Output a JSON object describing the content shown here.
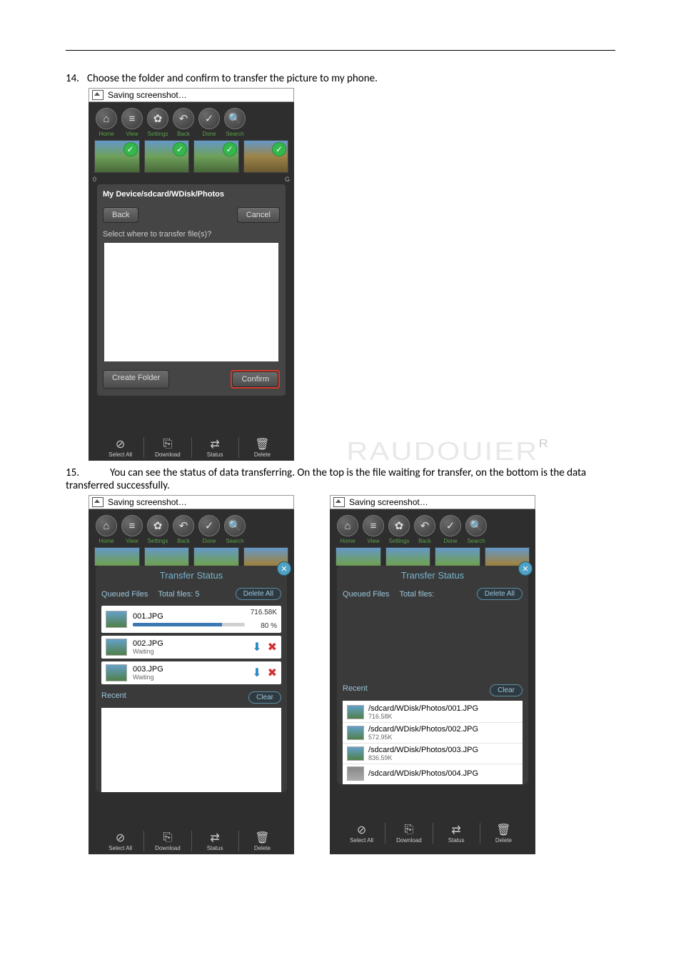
{
  "step14": {
    "num": "14.",
    "text": "Choose the folder and confirm to transfer the picture to my phone."
  },
  "step15": {
    "num": "15.",
    "text": "You can see the status of data transferring. On the top is the file waiting for transfer, on the bottom is the data transferred successfully."
  },
  "window_title": "Saving screenshot…",
  "toolbar": {
    "home": "Home",
    "view": "View",
    "settings": "Settings",
    "back": "Back",
    "done": "Done",
    "search": "Search"
  },
  "modal": {
    "path": "My Device/sdcard/WDisk/Photos",
    "back": "Back",
    "cancel": "Cancel",
    "prompt": "Select where to transfer file(s)?",
    "create_folder": "Create Folder",
    "confirm": "Confirm"
  },
  "edge_left": "0",
  "edge_right": "G",
  "bottom": {
    "select_all": "Select All",
    "download": "Download",
    "status": "Status",
    "delete": "Delete"
  },
  "transfer": {
    "title": "Transfer Status",
    "queued": "Queued Files",
    "total5": "Total files: 5",
    "totalBlank": "Total files:   ",
    "delete_all": "Delete All",
    "recent": "Recent",
    "clear": "Clear"
  },
  "queue_items": [
    {
      "name": "001.JPG",
      "right1": "716.58K",
      "right2": "80 %",
      "progress": true
    },
    {
      "name": "002.JPG",
      "status": "Waiting"
    },
    {
      "name": "003.JPG",
      "status": "Waiting"
    }
  ],
  "recent_items": [
    {
      "path": "/sdcard/WDisk/Photos/001.JPG",
      "size": "716.58K"
    },
    {
      "path": "/sdcard/WDisk/Photos/002.JPG",
      "size": "572.95K"
    },
    {
      "path": "/sdcard/WDisk/Photos/003.JPG",
      "size": "836.59K"
    },
    {
      "path": "/sdcard/WDisk/Photos/004.JPG",
      "size": ""
    }
  ],
  "watermark": {
    "text": "RAUDOUIER",
    "r": "R"
  }
}
